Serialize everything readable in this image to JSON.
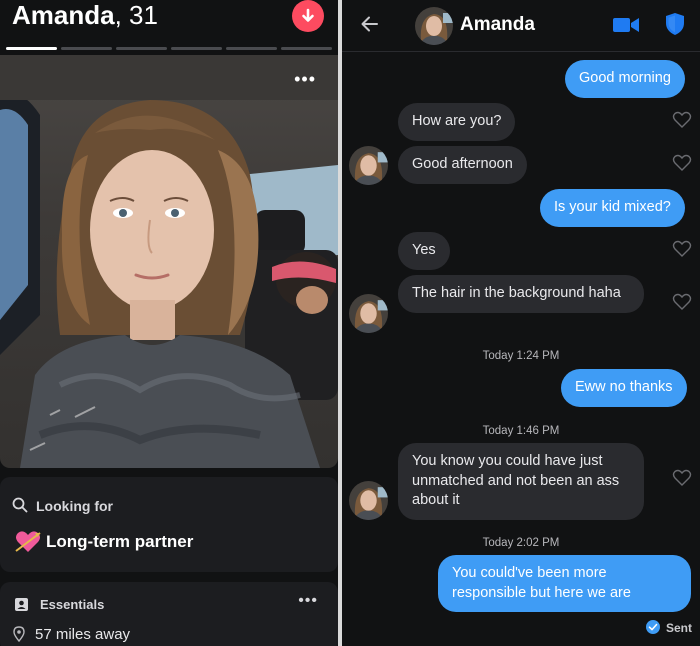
{
  "profile": {
    "name": "Amanda",
    "age_text": ", 31",
    "photo_count": 6,
    "active_photo_index": 0,
    "more_label": "•••",
    "looking_for": {
      "label": "Looking for",
      "value": "Long-term partner",
      "icon": "heart-arrow-icon"
    },
    "essentials": {
      "label": "Essentials",
      "more_label": "•••",
      "distance": "57 miles away"
    }
  },
  "chat": {
    "contact_name": "Amanda",
    "messages": [
      {
        "side": "out",
        "text": "Good morning"
      },
      {
        "side": "in",
        "text": "How are you?"
      },
      {
        "side": "in",
        "text": "Good afternoon"
      },
      {
        "side": "out",
        "text": "Is your kid mixed?"
      },
      {
        "side": "in",
        "text": "Yes"
      },
      {
        "side": "in",
        "text": "The hair in the background haha"
      },
      {
        "side": "out",
        "text": "Eww no thanks"
      },
      {
        "side": "in",
        "text": "You know you could have just unmatched and not been an ass about it"
      },
      {
        "side": "out",
        "text": "You could've been more responsible but here we are"
      }
    ],
    "timestamps": [
      "Today 1:24 PM",
      "Today 1:46 PM",
      "Today 2:02 PM"
    ],
    "status": "Sent"
  },
  "colors": {
    "accent_red": "#fd4b60",
    "outgoing_bubble": "#3f9cf5",
    "incoming_bubble": "#2a2b2f",
    "icon_blue": "#1f7bf2"
  }
}
